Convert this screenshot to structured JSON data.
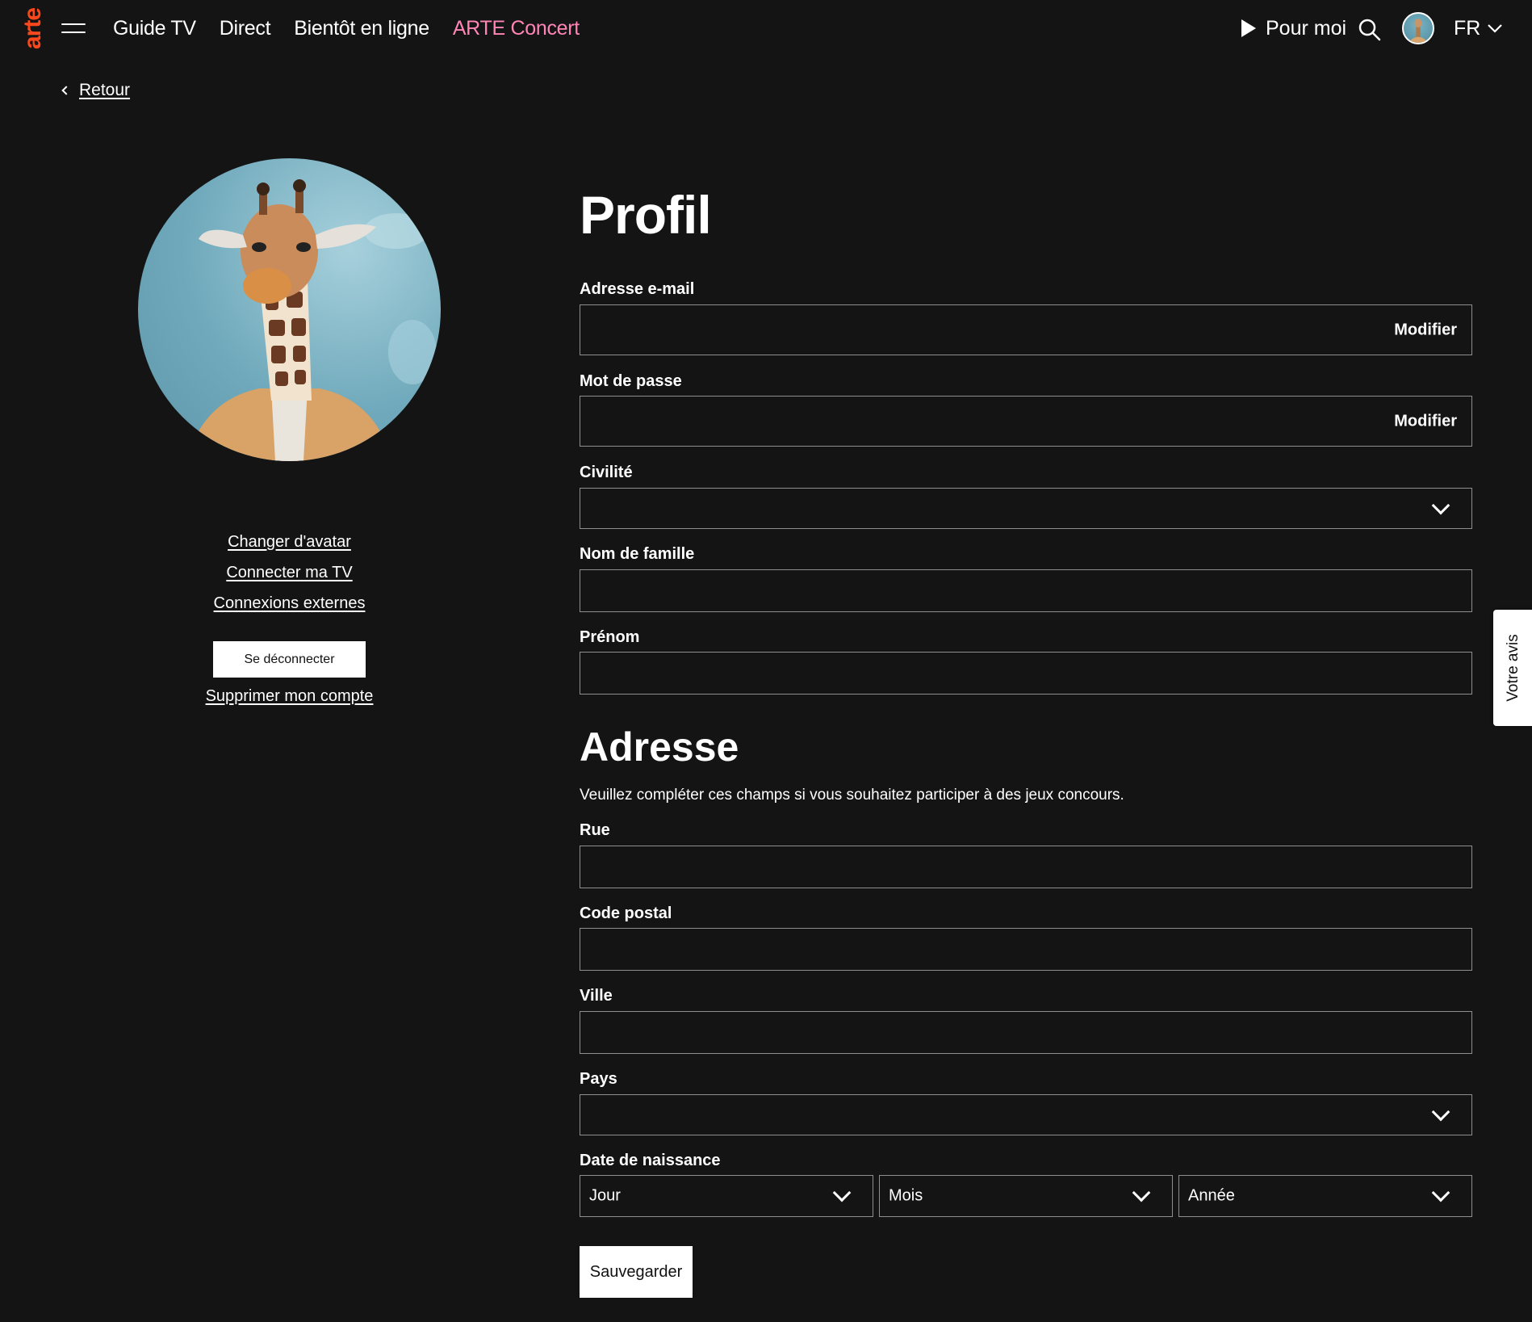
{
  "brand": {
    "logo_text": "arte",
    "logo_color": "#fa481c"
  },
  "nav": {
    "links": [
      "Guide TV",
      "Direct",
      "Bientôt en ligne",
      "ARTE Concert"
    ],
    "concert_color": "#ff85b6",
    "pour_moi": "Pour moi",
    "language": "FR"
  },
  "back": {
    "label": "Retour"
  },
  "sidebar": {
    "links": [
      "Changer d'avatar",
      "Connecter ma TV",
      "Connexions externes"
    ],
    "logout": "Se déconnecter",
    "delete": "Supprimer mon compte"
  },
  "profile": {
    "title": "Profil",
    "email_label": "Adresse e-mail",
    "email_action": "Modifier",
    "password_label": "Mot de passe",
    "password_action": "Modifier",
    "civility_label": "Civilité",
    "lastname_label": "Nom de famille",
    "firstname_label": "Prénom"
  },
  "address": {
    "title": "Adresse",
    "helper": "Veuillez compléter ces champs si vous souhaitez participer à des jeux concours.",
    "street_label": "Rue",
    "postal_label": "Code postal",
    "city_label": "Ville",
    "country_label": "Pays",
    "dob_label": "Date de naissance",
    "dob_day": "Jour",
    "dob_month": "Mois",
    "dob_year": "Année"
  },
  "save": "Sauvegarder",
  "feedback": "Votre avis"
}
